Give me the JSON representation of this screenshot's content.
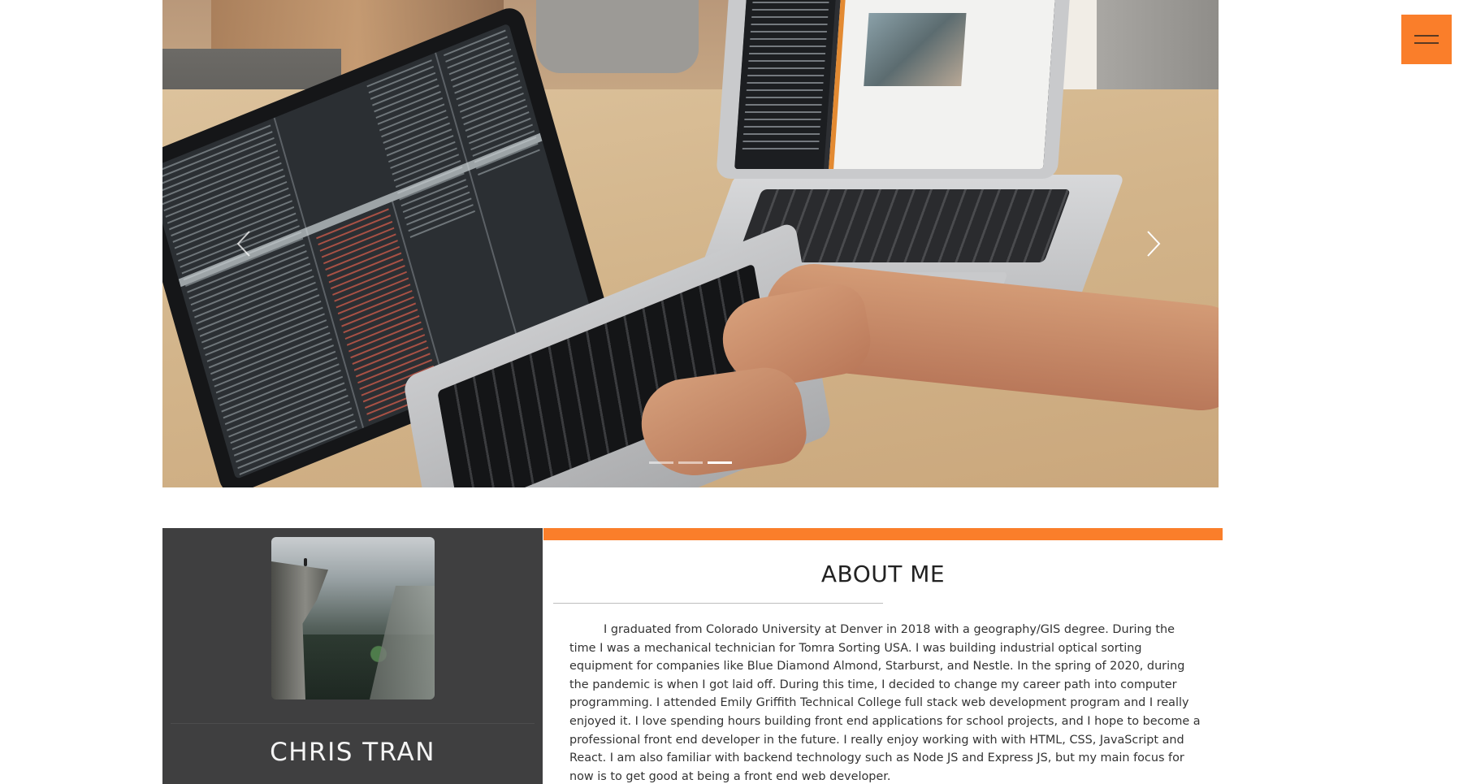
{
  "carousel": {
    "prev_icon": "chevron-left-icon",
    "next_icon": "chevron-right-icon",
    "slide_count": 3,
    "active_index": 2
  },
  "menu": {
    "icon": "hamburger-icon",
    "color": "#fa7e2a"
  },
  "profile": {
    "name": "CHRIS TRAN"
  },
  "about": {
    "title": "ABOUT ME",
    "body": "I graduated from Colorado University at Denver in 2018 with a geography/GIS degree. During the time I was a mechanical technician for Tomra Sorting USA. I was building industrial optical sorting equipment for companies like Blue Diamond Almond, Starburst, and Nestle. In the spring of 2020, during the pandemic is when I got laid off. During this time, I decided to change my career path into computer programming. I attended Emily Griffith Technical College full stack web development program and I really enjoyed it. I love spending hours building front end applications for school projects, and I hope to become a professional front end developer in the future. I really enjoy working with with HTML, CSS, JavaScript and React. I am also familiar with backend technology such as Node JS and Express JS, but my main focus for now is to get good at being a front end web developer."
  },
  "colors": {
    "accent": "#fa7e2a",
    "profile_bg": "#3f3f40"
  }
}
